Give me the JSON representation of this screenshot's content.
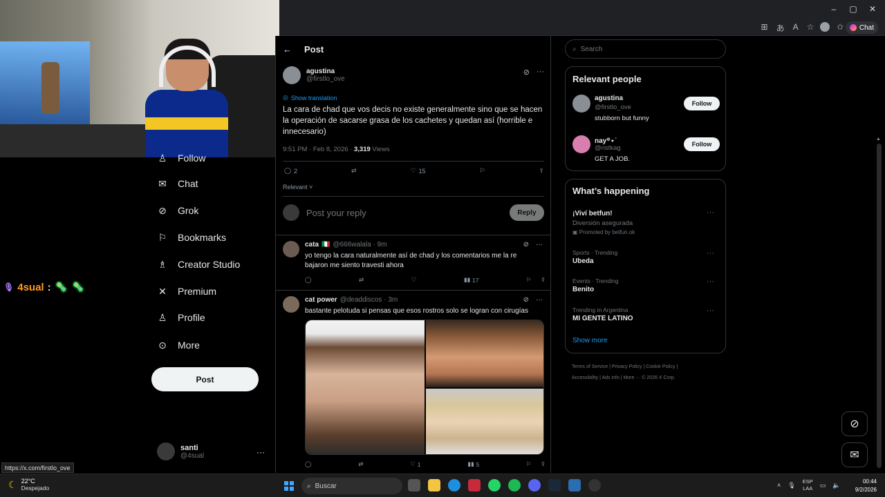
{
  "browser": {
    "window_controls": [
      "–",
      "▢",
      "✕"
    ],
    "chat_label": "Chat"
  },
  "webcam": {},
  "left_sidebar": {
    "items": [
      {
        "label": "Follow",
        "icon": "user-plus-icon"
      },
      {
        "label": "Chat",
        "icon": "mail-icon"
      },
      {
        "label": "Grok",
        "icon": "grok-icon"
      },
      {
        "label": "Bookmarks",
        "icon": "bookmark-icon"
      },
      {
        "label": "Creator Studio",
        "icon": "creator-icon"
      },
      {
        "label": "Premium",
        "icon": "x-logo-icon"
      },
      {
        "label": "Profile",
        "icon": "person-icon"
      },
      {
        "label": "More",
        "icon": "more-circle-icon"
      }
    ],
    "post_label": "Post",
    "account": {
      "name": "santi",
      "handle": "@4sual"
    }
  },
  "stream_chat": {
    "user": "4sual",
    "separator": ":",
    "emotes": "🦠 🦠"
  },
  "main": {
    "header_title": "Post",
    "op": {
      "name": "agustina",
      "handle": "@firstlo_ove",
      "show_translation": "Show translation",
      "text": "La cara de chad que vos decis no existe generalmente sino que se hacen la operación de sacarse grasa de los cachetes y quedan así (horrible e innecesario)",
      "time": "9:51 PM · Feb 8, 2026 · ",
      "views_count": "3,319",
      "views_label": " Views",
      "replies": "2",
      "likes": "15"
    },
    "sort_label": "Relevant",
    "reply_placeholder": "Post your reply",
    "reply_button": "Reply",
    "replies": [
      {
        "name": "cata",
        "handle": "@666walala · 9m",
        "text": "yo tengo  la cara naturalmente así de chad y los comentarios me la re bajaron me siento travesti ahora",
        "views": "17",
        "likes": ""
      },
      {
        "name": "cat power",
        "handle": "@deaddiscos · 3m",
        "text": "bastante pelotuda si pensas que esos rostros solo se logran con cirugías",
        "views": "5",
        "likes": "1"
      }
    ]
  },
  "right": {
    "search_placeholder": "Search",
    "relevant_title": "Relevant people",
    "people": [
      {
        "name": "agustina",
        "handle": "@firstlo_ove",
        "bio": "stubborn but funny",
        "follow": "Follow"
      },
      {
        "name": "nay꙳⋆˙",
        "handle": "@nstkag",
        "bio": "GET A JOB.",
        "follow": "Follow"
      }
    ],
    "happening_title": "What’s happening",
    "trends": [
      {
        "category": "",
        "title": "¡Viví betfun!",
        "sub": "Diversión asegurada",
        "promo": "Promoted by betfun.ok"
      },
      {
        "category": "Sports · Trending",
        "title": "Ubeda",
        "sub": "",
        "promo": ""
      },
      {
        "category": "Events · Trending",
        "title": "Benito",
        "sub": "",
        "promo": ""
      },
      {
        "category": "Trending in Argentina",
        "title": "MI GENTE LATINO",
        "sub": "",
        "promo": ""
      }
    ],
    "show_more": "Show more",
    "footer_line1": "Terms of Service  |  Privacy Policy  |  Cookie Policy  |",
    "footer_line2": "Accessibility  |  Ads info  |  More ···  ©  2026 X Corp."
  },
  "status_url": "https://x.com/firstlo_ove",
  "taskbar": {
    "temp": "22°C",
    "weather": "Despejado",
    "search": "Buscar",
    "lang1": "ESP",
    "lang2": "LAA",
    "time": "00:44",
    "date": "9/2/2026"
  }
}
